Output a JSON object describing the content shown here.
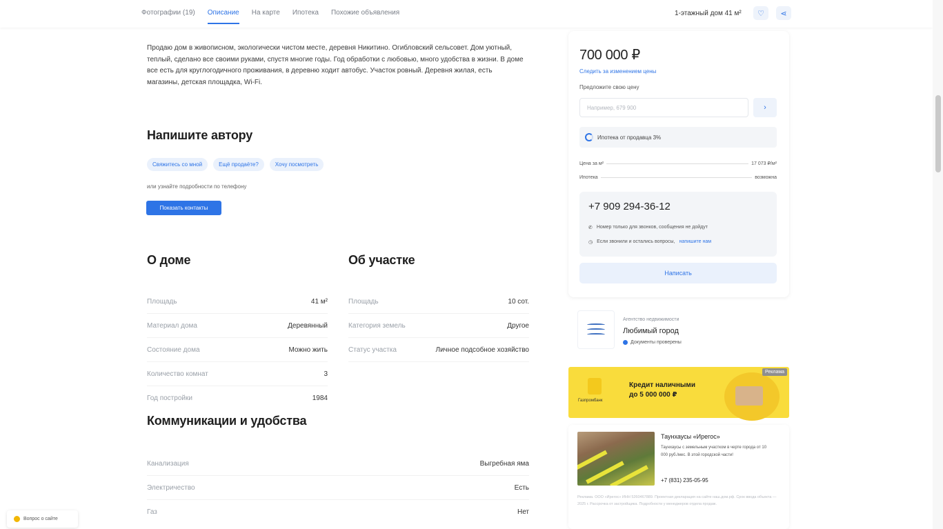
{
  "nav": {
    "tabs": [
      "Фотографии (19)",
      "Описание",
      "На карте",
      "Ипотека",
      "Похожие объявления"
    ],
    "active_tab": 1,
    "right_title": "1-этажный дом 41 м²"
  },
  "description": "Продаю дом в живописном, экологически чистом месте, деревня Никитино. Огибловский сельсовет. Дом уютный, теплый, сделано все своими руками, спустя многие годы. Год обработки с любовью, много удобства в жизни. В доме все есть для круглогодичного проживания, в деревню ходит автобус. Участок ровный. Деревня жилая, есть магазины, детская площадка, Wi-Fi.",
  "write_author": {
    "title": "Напишите автору",
    "chips": [
      "Свяжитесь со мной",
      "Ещё продаёте?",
      "Хочу посмотреть"
    ],
    "note": "или узнайте подробности по телефону",
    "button": "Показать контакты"
  },
  "house": {
    "title": "О доме",
    "rows": [
      {
        "label": "Площадь",
        "value": "41 м²"
      },
      {
        "label": "Материал дома",
        "value": "Деревянный"
      },
      {
        "label": "Состояние дома",
        "value": "Можно жить"
      },
      {
        "label": "Количество комнат",
        "value": "3"
      },
      {
        "label": "Год постройки",
        "value": "1984"
      }
    ]
  },
  "plot": {
    "title": "Об участке",
    "rows": [
      {
        "label": "Площадь",
        "value": "10 сот."
      },
      {
        "label": "Категория земель",
        "value": "Другое"
      },
      {
        "label": "Статус участка",
        "value": "Личное подсобное хозяйство"
      }
    ]
  },
  "utilities": {
    "title": "Коммуникации и удобства",
    "rows": [
      {
        "label": "Канализация",
        "value": "Выгребная яма"
      },
      {
        "label": "Электричество",
        "value": "Есть"
      },
      {
        "label": "Газ",
        "value": "Нет"
      }
    ]
  },
  "sidebar": {
    "price": "700 000 ₽",
    "price_link": "Следить за изменением цены",
    "offer_label": "Предложите свою цену",
    "offer_placeholder": "Например, 679 900",
    "offer_send_icon": "arrow-right-icon",
    "ipoteka": "Ипотека от продавца 3%",
    "kv": [
      {
        "label": "Цена за м²",
        "value": "17 073 ₽/м²"
      },
      {
        "label": "Ипотека",
        "value": "возможна"
      }
    ],
    "phone": "+7 909 294-36-12",
    "phone_note1": "Номер только для звонков, сообщения не дойдут",
    "phone_note2": "Если звонили и остались вопросы,",
    "phone_note2_link": "напишите нам",
    "write_button": "Написать"
  },
  "agency": {
    "type": "Агентство недвижимости",
    "name": "Любимый город",
    "docs": "Документы проверены"
  },
  "banner": {
    "tag": "Реклама",
    "line1": "Кредит наличными",
    "line2": "до 5 000 000 ₽",
    "logo": "Газпромбанк"
  },
  "ad": {
    "title": "Таунхаусы «Ирегос»",
    "desc": "Таунхаусы с земельным участком в черте города от 10 000 руб./мес. В этой городской части!",
    "phone": "+7 (831) 235-05-95",
    "fine": "Реклама. ООО «Ирегос» ИНН 5260467889. Проектная декларация на сайте наш.дом.рф. Срок ввода объекта — 2025 г. Рассрочка от застройщика. Подробности у менеджеров отдела продаж."
  },
  "feedback": "Вопрос о сайте"
}
